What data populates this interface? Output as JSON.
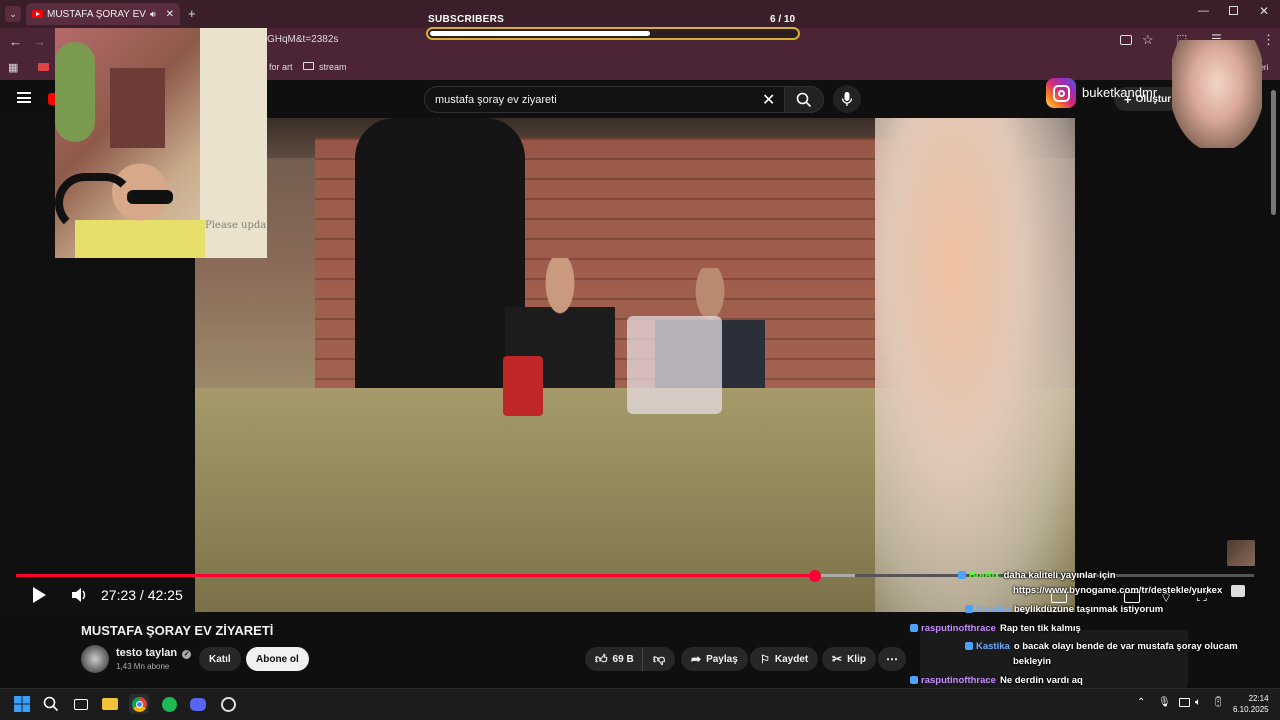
{
  "browser": {
    "tab_title": "MUSTAFA ŞORAY EV ZİYARE",
    "url_fragment": "GHqM&t=2382s",
    "bookmarks": [
      "for art",
      "stream"
    ],
    "bookmarks_right": "etleri"
  },
  "overlay": {
    "subs_label": "SUBSCRIBERS",
    "subs_count": "6  / 10",
    "subs_progress": 0.6,
    "webcam_text": "Please update stream l",
    "instagram_handle": "buketkandmr"
  },
  "youtube": {
    "search_query": "mustafa şoray ev ziyareti",
    "create_label": "Oluştur",
    "time": "27:23 / 42:25",
    "progress": 0.645,
    "buffered": 0.678,
    "video_title": "MUSTAFA ŞORAY EV ZİYARETİ",
    "channel": "testo taylan",
    "subscribers": "1,43 Mn abone",
    "join_label": "Katıl",
    "subscribe_label": "Abone ol",
    "likes": "69 B",
    "share_label": "Paylaş",
    "save_label": "Kaydet",
    "clip_label": "Klip"
  },
  "chat": [
    {
      "user": "BotRix",
      "color": "#5dff3d",
      "msg": "daha kaliteli yayınlar için"
    },
    {
      "user": "",
      "color": "#ffffff",
      "msg": "https://www.bynogame.com/tr/destekle/yurkex"
    },
    {
      "user": "Kastika",
      "color": "#6aa9ff",
      "msg": "beylikdüzüne taşınmak istiyorum"
    },
    {
      "user": "rasputinofthrace",
      "color": "#c48bff",
      "msg": "Rap ten tik kalmış"
    },
    {
      "user": "Kastika",
      "color": "#6aa9ff",
      "msg": "o bacak olayı bende de var mustafa şoray olucam"
    },
    {
      "user": "",
      "color": "#ffffff",
      "msg": "bekleyin"
    },
    {
      "user": "rasputinofthrace",
      "color": "#c48bff",
      "msg": "Ne derdin vardı aq"
    }
  ],
  "taskbar": {
    "time": "22:14",
    "date": "6.10.2025"
  }
}
